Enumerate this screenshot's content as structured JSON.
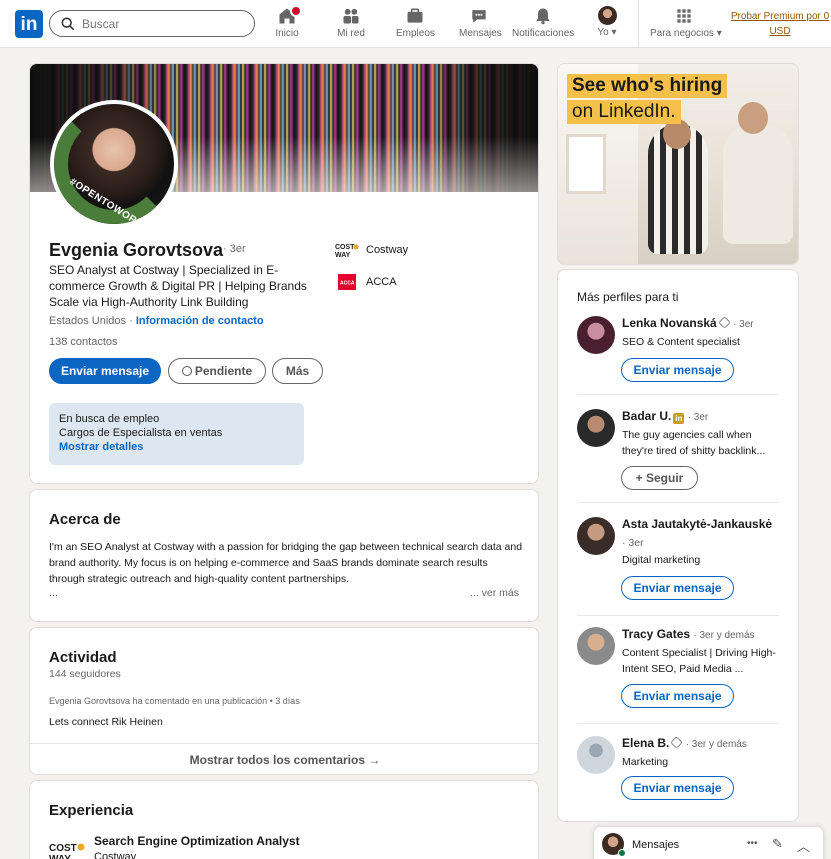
{
  "nav": {
    "search_placeholder": "Buscar",
    "items": [
      {
        "label": "Inicio"
      },
      {
        "label": "Mi red"
      },
      {
        "label": "Empleos"
      },
      {
        "label": "Mensajes"
      },
      {
        "label": "Notificaciones"
      },
      {
        "label": "Yo"
      },
      {
        "label": "Para negocios"
      }
    ],
    "premium": "Probar Premium por 0 USD"
  },
  "profile": {
    "name": "Evgenia Gorovtsova",
    "degree": "· 3er",
    "headline": "SEO Analyst at Costway | Specialized in E-commerce Growth & Digital PR | Helping Brands Scale via High-Authority Link Building",
    "location": "Estados Unidos ·",
    "contact_info": "Información de contacto",
    "contacts": "138 contactos",
    "badge_text": "#OPENTOWORK",
    "companies": [
      {
        "name": "Costway",
        "logo": "COST WAY"
      },
      {
        "name": "ACCA",
        "logo": "ACCA"
      }
    ],
    "buttons": {
      "message": "Enviar mensaje",
      "pending": "Pendiente",
      "more": "Más"
    },
    "open_to_work": {
      "title": "En busca de empleo",
      "roles": "Cargos de Especialista en ventas",
      "link": "Mostrar detalles"
    }
  },
  "about": {
    "title": "Acerca de",
    "text": "I'm an SEO Analyst at Costway with a passion for bridging the gap between technical search data and brand authority. My focus is on helping e-commerce and SaaS brands dominate search results through strategic outreach and high-quality content partnerships.",
    "ellipsis": "...",
    "see_more": "... ver más"
  },
  "activity": {
    "title": "Actividad",
    "followers": "144 seguidores",
    "meta": "Evgenia Gorovtsova ha comentado en una publicación • 3 días",
    "text": "Lets connect Rik Heinen",
    "footer": "Mostrar todos los comentarios →"
  },
  "experience": {
    "title": "Experiencia",
    "role": "Search Engine Optimization Analyst",
    "company": "Costway"
  },
  "ad": {
    "line1": "See who's hiring",
    "line2": "on LinkedIn."
  },
  "people": {
    "title": "Más perfiles para ti",
    "list": [
      {
        "name": "Lenka Novanská",
        "degree": "· 3er",
        "headline": "SEO & Content specialist",
        "button": "Enviar mensaje"
      },
      {
        "name": "Badar U.",
        "degree": "· 3er",
        "headline": "The guy agencies call when they're tired of shitty backlink...",
        "button": "Seguir"
      },
      {
        "name": "Asta Jautakytė-Jankauskė",
        "degree": "· 3er",
        "headline": "Digital marketing",
        "button": "Enviar mensaje"
      },
      {
        "name": "Tracy Gates",
        "degree": "· 3er y demás",
        "headline": "Content Specialist | Driving High-Intent SEO, Paid Media ...",
        "button": "Enviar mensaje"
      },
      {
        "name": "Elena B.",
        "degree": "· 3er y demás",
        "headline": "Marketing",
        "button": "Enviar mensaje"
      }
    ]
  },
  "messaging": {
    "label": "Mensajes",
    "more": "•••"
  },
  "colors": {
    "brand": "#0a66c2",
    "premium": "#915907",
    "open_to_work": "#4a7c3a"
  }
}
